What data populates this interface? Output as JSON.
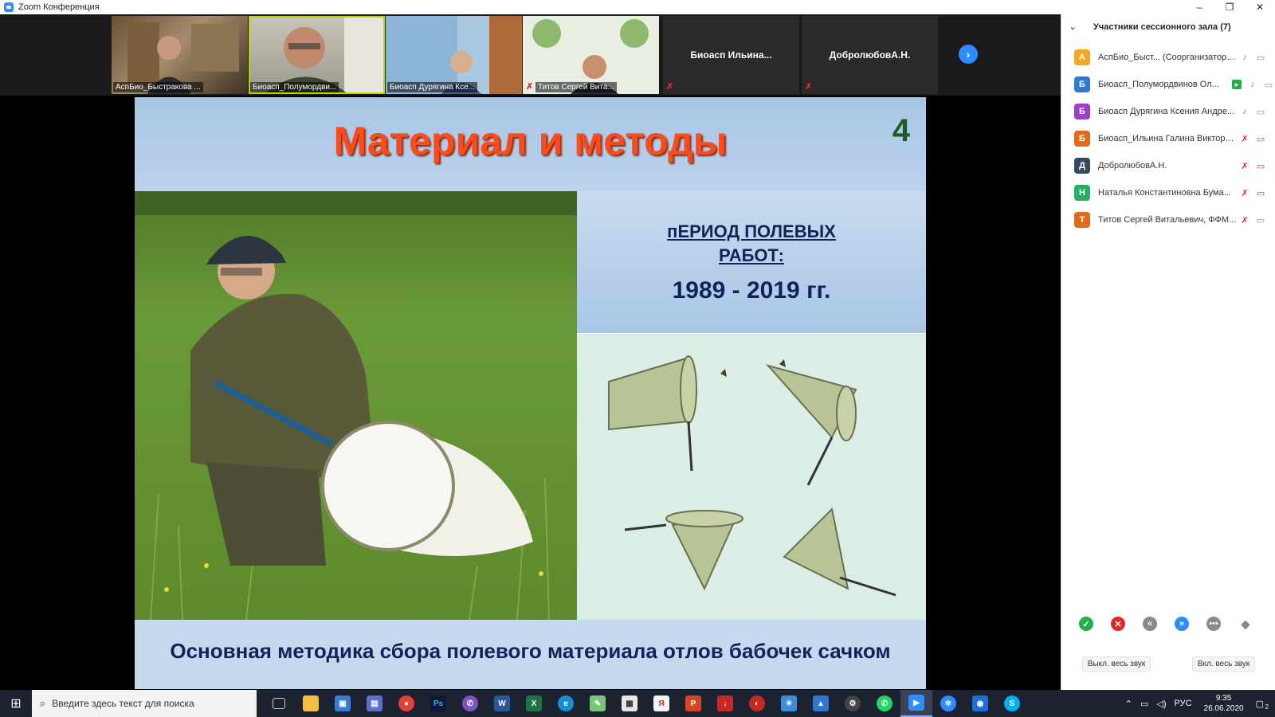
{
  "window": {
    "title": "Zoom Конференция",
    "buttons": [
      "–",
      "❐",
      "✕"
    ]
  },
  "gallery": {
    "tiles": [
      {
        "name": "АспБио_Быстракова ..."
      },
      {
        "name": "Биоасп_Полумордви..."
      },
      {
        "name": "Биоасп Дурягина Ксе..."
      },
      {
        "name": "Титов Сергей Вита..."
      },
      {
        "name": "Биоасп Ильина..."
      },
      {
        "name": "ДобролюбовА.Н."
      }
    ]
  },
  "slide": {
    "title": "Материал и методы",
    "number": "4",
    "period_title_line1": "пЕРИОД ПОЛЕВЫХ",
    "period_title_line2": "РАБОТ:",
    "period_years": "1989 - 2019 гг.",
    "caption": "Основная методика сбора полевого материала отлов бабочек сачком"
  },
  "panel": {
    "header": "Участники сессионного зала (7)",
    "participants": [
      {
        "initial": "А",
        "color": "#f5a623",
        "name": "АспБио_Быст... (Соорганизатор, я)"
      },
      {
        "initial": "Б",
        "color": "#2d7bd1",
        "name": "Биоасп_Полумордвинов Ол..."
      },
      {
        "initial": "Б",
        "color": "#9b3fc8",
        "name": "Биоасп Дурягина Ксения Андре..."
      },
      {
        "initial": "Б",
        "color": "#e26a1c",
        "name": "Биоасп_Ильина Галина Викторо..."
      },
      {
        "initial": "Д",
        "color": "#34495e",
        "name": "ДобролюбовА.Н."
      },
      {
        "initial": "Н",
        "color": "#27ae60",
        "name": "Наталья Константиновна Бума..."
      },
      {
        "initial": "Т",
        "color": "#e26a1c",
        "name": "Титов Сергей Витальевич, ФФМ..."
      }
    ],
    "mute_all": "Выкл. весь звук",
    "unmute_all": "Вкл. весь звук"
  },
  "taskbar": {
    "search_placeholder": "Введите здесь текст для поиска",
    "lang": "РУС",
    "time": "9:35",
    "date": "26.06.2020",
    "notifications": "2"
  }
}
